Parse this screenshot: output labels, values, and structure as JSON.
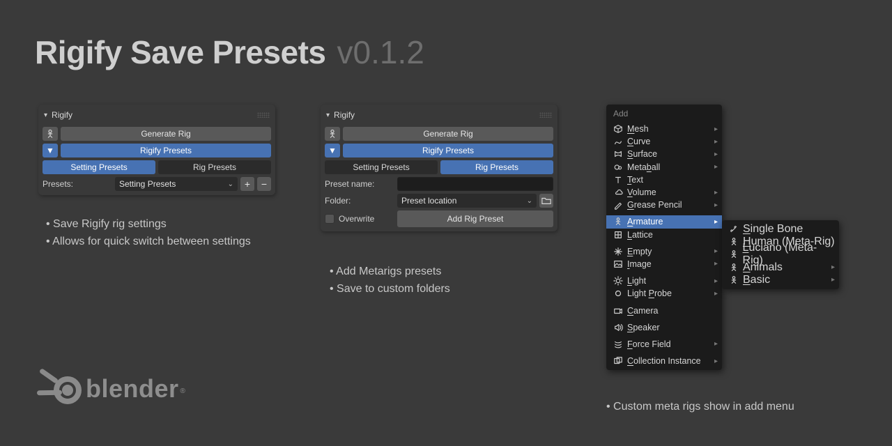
{
  "title": {
    "name": "Rigify Save Presets",
    "version": "v0.1.2"
  },
  "panel1": {
    "header": "Rigify",
    "generate": "Generate Rig",
    "presets_toggle": "Rigify Presets",
    "tab_settings": "Setting Presets",
    "tab_rig": "Rig Presets",
    "presets_label": "Presets:",
    "presets_value": "Setting Presets",
    "bullets": [
      "Save Rigify rig settings",
      "Allows for quick switch between settings"
    ]
  },
  "panel2": {
    "header": "Rigify",
    "generate": "Generate Rig",
    "presets_toggle": "Rigify Presets",
    "tab_settings": "Setting Presets",
    "tab_rig": "Rig Presets",
    "name_label": "Preset name:",
    "folder_label": "Folder:",
    "folder_value": "Preset location",
    "overwrite": "Overwrite",
    "add_btn": "Add Rig Preset",
    "bullets": [
      "Add Metarigs presets",
      "Save to custom folders"
    ]
  },
  "addmenu": {
    "title": "Add",
    "items": [
      {
        "label": "Mesh",
        "u": "M",
        "arrow": true
      },
      {
        "label": "Curve",
        "u": "C",
        "arrow": true
      },
      {
        "label": "Surface",
        "u": "S",
        "arrow": true
      },
      {
        "label": "Metaball",
        "u": "b",
        "arrow": true,
        "upos": 4
      },
      {
        "label": "Text",
        "u": "T"
      },
      {
        "label": "Volume",
        "u": "V",
        "arrow": true
      },
      {
        "label": "Grease Pencil",
        "u": "G",
        "arrow": true
      },
      {
        "sep": true
      },
      {
        "label": "Armature",
        "u": "A",
        "arrow": true,
        "selected": true
      },
      {
        "label": "Lattice",
        "u": "L"
      },
      {
        "sep": true
      },
      {
        "label": "Empty",
        "u": "E",
        "arrow": true
      },
      {
        "label": "Image",
        "u": "I",
        "arrow": true
      },
      {
        "sep": true
      },
      {
        "label": "Light",
        "u": "L",
        "arrow": true
      },
      {
        "label": "Light Probe",
        "u": "P",
        "arrow": true,
        "upos": 6
      },
      {
        "sep": true
      },
      {
        "label": "Camera",
        "u": "C"
      },
      {
        "sep": true
      },
      {
        "label": "Speaker",
        "u": "S"
      },
      {
        "sep": true
      },
      {
        "label": "Force Field",
        "u": "F",
        "arrow": true
      },
      {
        "sep": true
      },
      {
        "label": "Collection Instance",
        "u": "C",
        "arrow": true
      }
    ],
    "sub": [
      {
        "label": "Single Bone",
        "u": "S"
      },
      {
        "label": "Human (Meta-Rig)",
        "u": "H"
      },
      {
        "label": "Luciano (Meta-Rig)",
        "u": "L"
      },
      {
        "label": "Animals",
        "u": "A",
        "arrow": true
      },
      {
        "label": "Basic",
        "u": "B",
        "arrow": true
      }
    ],
    "note": "Custom meta rigs show in add menu"
  },
  "logo": {
    "word": "blender"
  }
}
